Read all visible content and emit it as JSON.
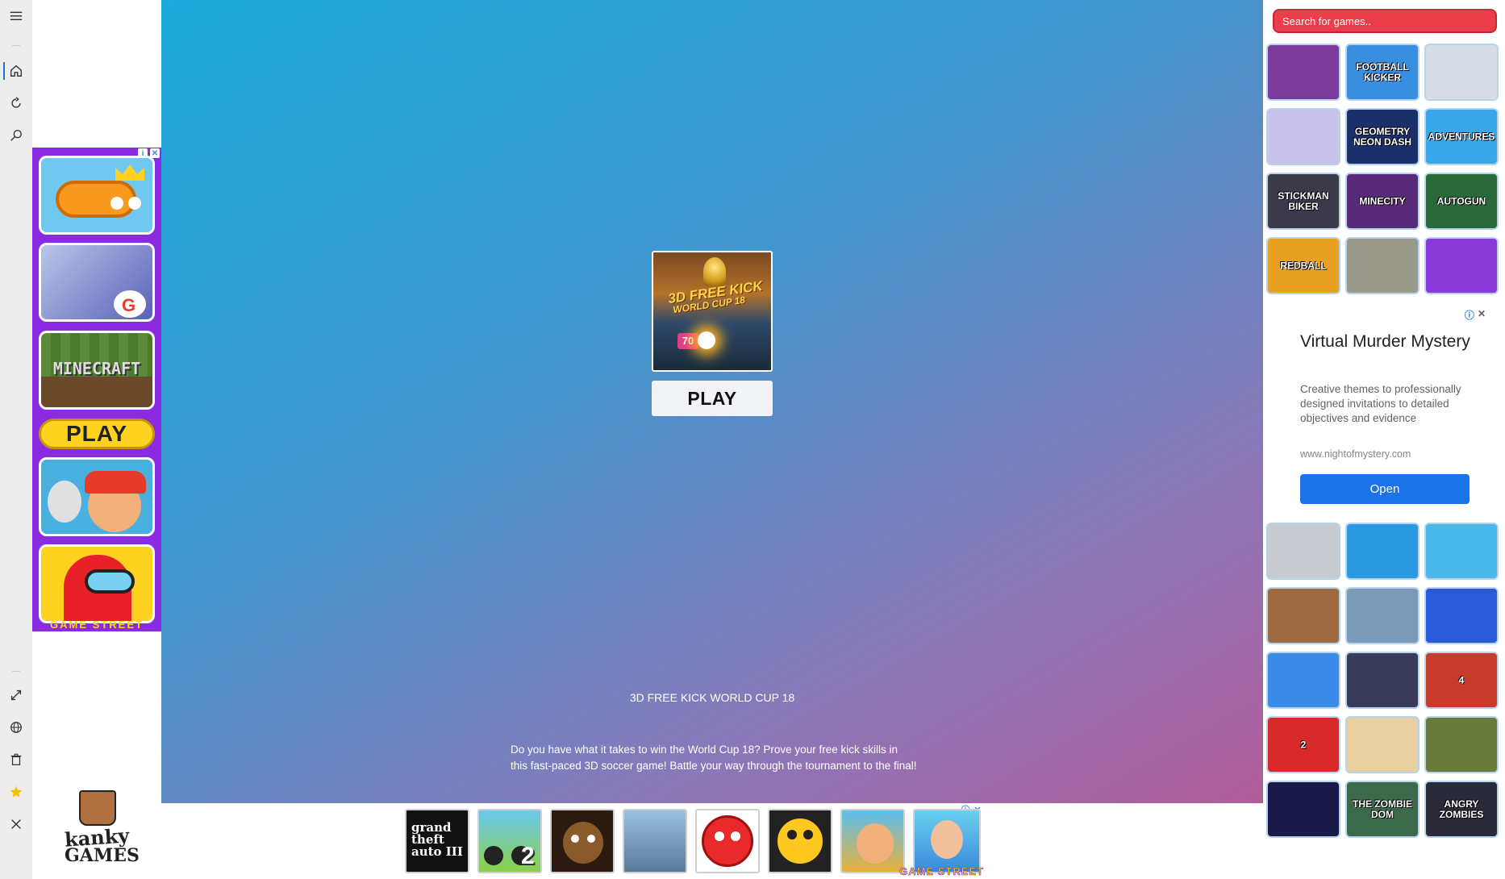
{
  "search": {
    "placeholder": "Search for games.."
  },
  "rail_icons": [
    "menu-icon",
    "home-icon",
    "history-icon",
    "search-icon",
    "fullscreen-icon",
    "language-icon",
    "trash-icon",
    "star-icon",
    "close-icon"
  ],
  "left_ad": {
    "play_label": "PLAY",
    "minecraft_label": "MINECRAFT",
    "brand": "GAME STREET"
  },
  "logo": {
    "line1": "kanky",
    "line2": "GAMES"
  },
  "main": {
    "thumb_title": "3D FREE KICK",
    "thumb_subtitle": "WORLD CUP 18",
    "thumb_number": "70",
    "play_label": "PLAY",
    "game_title": "3D FREE KICK WORLD CUP 18",
    "game_description": "Do you have what it takes to win the World Cup 18? Prove your free kick skills in this fast-paced 3D soccer game! Battle your way through the tournament to the final!"
  },
  "bottom_ad": {
    "items": [
      "grand theft auto III",
      "2",
      "",
      "",
      "",
      "",
      "",
      ""
    ],
    "brand": "GAME STREET"
  },
  "sidebar_top_games": [
    {
      "label": "",
      "bg": "#7a3a9a"
    },
    {
      "label": "FOOTBALL KICKER",
      "bg": "#3a8ee0"
    },
    {
      "label": "",
      "bg": "#d8dce4"
    },
    {
      "label": "",
      "bg": "#c9c2ea"
    },
    {
      "label": "GEOMETRY NEON DASH",
      "bg": "#1b2f6a"
    },
    {
      "label": "ADVENTURES",
      "bg": "#3aa8e8"
    },
    {
      "label": "STICKMAN BIKER",
      "bg": "#3a3a4a"
    },
    {
      "label": "MINECITY",
      "bg": "#5a2a7a"
    },
    {
      "label": "AUTOGUN",
      "bg": "#2a6a3a"
    },
    {
      "label": "REDBALL",
      "bg": "#e8a020"
    },
    {
      "label": "",
      "bg": "#9a9a8a"
    },
    {
      "label": "",
      "bg": "#8a3ad8"
    }
  ],
  "sidebar_ad": {
    "headline": "Virtual Murder Mystery",
    "description": "Creative themes to professionally designed invitations to detailed objectives and evidence",
    "url": "www.nightofmystery.com",
    "button": "Open"
  },
  "sidebar_bottom_games": [
    {
      "label": "",
      "bg": "#c8ccd0"
    },
    {
      "label": "",
      "bg": "#2a9ae0"
    },
    {
      "label": "",
      "bg": "#4ab8e8"
    },
    {
      "label": "",
      "bg": "#a06a40"
    },
    {
      "label": "",
      "bg": "#7a9ab8"
    },
    {
      "label": "",
      "bg": "#2a5ad8"
    },
    {
      "label": "",
      "bg": "#3a8ae8"
    },
    {
      "label": "",
      "bg": "#3a3a5a"
    },
    {
      "label": "4",
      "bg": "#c83a2a"
    },
    {
      "label": "2",
      "bg": "#d82a2a"
    },
    {
      "label": "",
      "bg": "#e8d0a0"
    },
    {
      "label": "",
      "bg": "#6a7a3a"
    },
    {
      "label": "",
      "bg": "#1a1a4a"
    },
    {
      "label": "THE ZOMBIE DOM",
      "bg": "#3a6a4a"
    },
    {
      "label": "ANGRY ZOMBIES",
      "bg": "#2a2a3a"
    }
  ]
}
